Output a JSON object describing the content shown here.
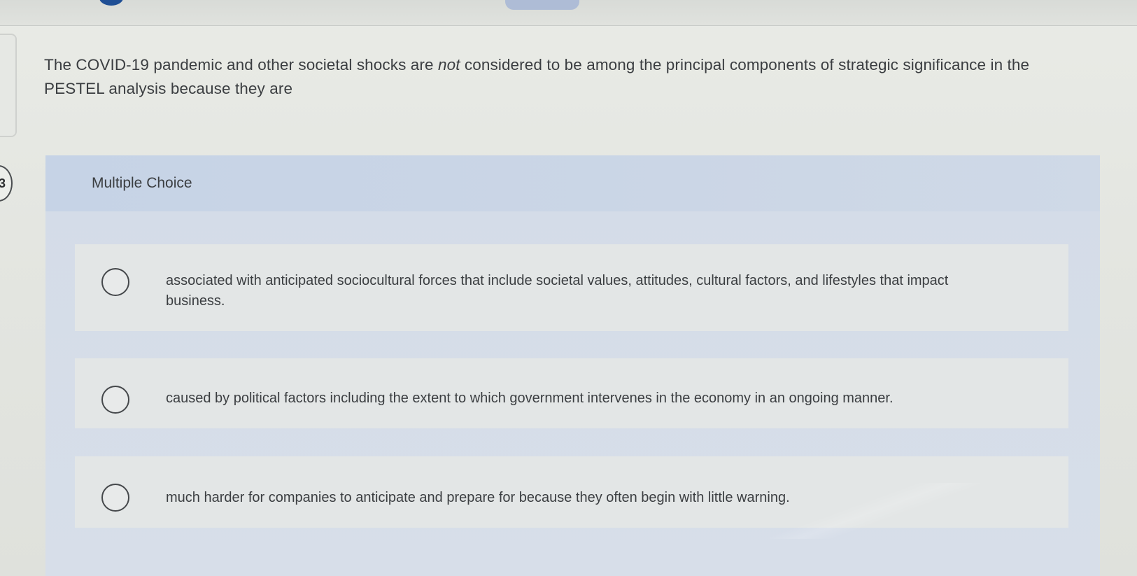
{
  "question": {
    "number": "3",
    "prompt_before": "The COVID-19 pandemic and other societal shocks are ",
    "prompt_emphasis": "not",
    "prompt_after": " considered to be among the principal components of strategic significance in the PESTEL analysis because they are"
  },
  "multiple_choice": {
    "header": "Multiple Choice",
    "options": [
      {
        "text": "associated with anticipated sociocultural forces that include societal values, attitudes, cultural factors, and lifestyles that impact business.",
        "selected": false
      },
      {
        "text": "caused by political factors including the extent to which government intervenes in the economy in an ongoing manner.",
        "selected": false
      },
      {
        "text": "much harder for companies to anticipate and prepare for because they often begin with little warning.",
        "selected": false
      }
    ]
  },
  "colors": {
    "panel": "#d4dce8",
    "header": "#c6d3e6",
    "choice_bg": "#e3e6e6",
    "text": "#3b3e41",
    "accent": "#1f4f95"
  }
}
